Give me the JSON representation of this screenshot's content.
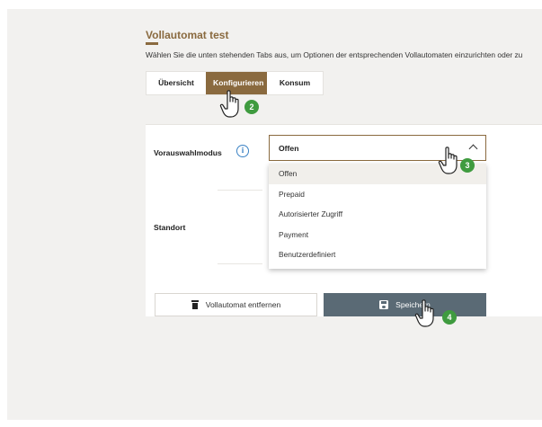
{
  "header": {
    "title": "Vollautomat test",
    "subtitle": "Wählen Sie die unten stehenden Tabs aus, um Optionen der entsprechenden Vollautomaten einzurichten oder zu"
  },
  "tabs": [
    {
      "label": "Übersicht",
      "active": false
    },
    {
      "label": "Konfigurieren",
      "active": true
    },
    {
      "label": "Konsum",
      "active": false
    }
  ],
  "form": {
    "mode_label": "Vorauswahlmodus",
    "mode_value": "Offen",
    "standort_label": "Standort",
    "options": [
      "Offen",
      "Prepaid",
      "Autorisierter Zugriff",
      "Payment",
      "Benutzerdefiniert"
    ],
    "highlighted_option": "Offen"
  },
  "actions": {
    "remove_label": "Vollautomat entfernen",
    "save_label": "Speichern"
  },
  "annotations": {
    "step_2": "2",
    "step_3": "3",
    "step_4": "4"
  },
  "colors": {
    "accent": "#8a6a3f",
    "save_button": "#5a6a75",
    "badge": "#3f9b3f",
    "info": "#3b82c4"
  },
  "icons": [
    "info-icon",
    "chevron-up-icon",
    "trash-icon",
    "floppy-disk-icon",
    "hand-pointer-icon"
  ]
}
